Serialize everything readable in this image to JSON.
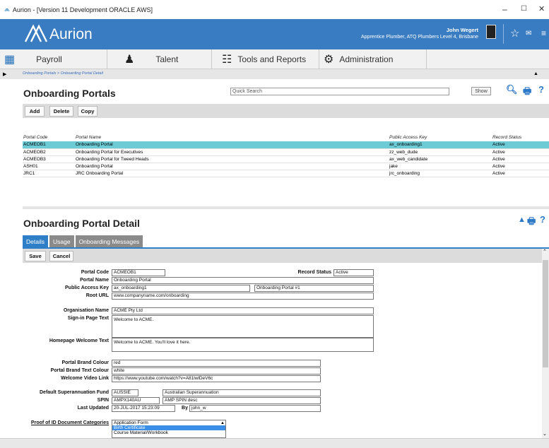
{
  "window": {
    "title": "Aurion - [Version 11 Development ORACLE AWS]",
    "minimize": "–",
    "maximize": "☐",
    "close": "✕"
  },
  "header": {
    "brand": "Aurion",
    "user_name": "John Wegert",
    "user_role": "Apprentice Plumber, ATQ Plumbers Level 4, Brisbane",
    "accent": "#3a7cc1"
  },
  "nav": {
    "items": [
      {
        "label": "Payroll",
        "icon": "payroll-icon"
      },
      {
        "label": "Talent",
        "icon": "talent-icon"
      },
      {
        "label": "Tools and Reports",
        "icon": "reports-icon"
      },
      {
        "label": "Administration",
        "icon": "admin-gears-icon"
      }
    ]
  },
  "breadcrumb": {
    "path": "Onboarding Portals   > Onboarding Portal Detail"
  },
  "portals": {
    "title": "Onboarding Portals",
    "search_placeholder": "Quick Search",
    "show_label": "Show",
    "buttons": {
      "add": "Add",
      "delete": "Delete",
      "copy": "Copy"
    },
    "columns": [
      "Portal Code",
      "Portal Name",
      "Public Access Key",
      "Record Status"
    ],
    "rows": [
      [
        "ACMEOB1",
        "Onboarding Portal",
        "ax_onboarding1",
        "Active"
      ],
      [
        "ACMEOB2",
        "Onboarding Portal for Executives",
        "zz_web_dude",
        "Active"
      ],
      [
        "ACMEOB3",
        "Onboarding Portal for Tweed Heads",
        "ax_web_candidate",
        "Active"
      ],
      [
        "ASH01",
        "Onboarding Portal",
        "jake",
        "Active"
      ],
      [
        "JRC1",
        "JRC Onboarding Portal",
        "jrc_onboarding",
        "Active"
      ]
    ]
  },
  "detail": {
    "title": "Onboarding Portal Detail",
    "tabs": [
      "Details",
      "Usage",
      "Onboarding Messages"
    ],
    "buttons": {
      "save": "Save",
      "cancel": "Cancel"
    },
    "labels": {
      "portal_code": "Portal Code",
      "portal_name": "Portal Name",
      "public_access_key": "Public Access Key",
      "root_url": "Root URL",
      "record_status": "Record Status",
      "org_name": "Organisation Name",
      "signin_text": "Sign-in Page Text",
      "homepage_text": "Homepage Welcome Text",
      "brand_colour": "Portal Brand Colour",
      "brand_text_colour": "Portal Brand Text Colour",
      "video_link": "Welcome Video Link",
      "super_fund": "Default Superannuation Fund",
      "spin": "SPIN",
      "last_updated": "Last Updated",
      "by": "By",
      "proof_id": "Proof of ID Document Categories"
    },
    "values": {
      "portal_code": "ACMEOB1",
      "portal_name": "Onboarding Portal",
      "public_access_key": "ax_onboarding1",
      "public_access_key_desc": "Onboarding Portal #1",
      "root_url": "www.companyname.com/onboarding",
      "record_status": "Active",
      "org_name": "ACME Pty Ltd",
      "signin_text": "Welcome to ACME.",
      "homepage_text": "Welcome to ACME. You'll love it here.",
      "brand_colour": "red",
      "brand_text_colour": "white",
      "video_link": "https://www.youtube.com/watch?v=A81lwlDeV6c",
      "super_fund_code": "AUSSIE",
      "super_fund_name": "Australian Superannuation",
      "spin": "AMPX140AU",
      "spin_desc": "AMP SPIN desc",
      "last_updated": "20-JUL-2017 15:23:09",
      "by": "john_w"
    },
    "proof_id_options": [
      "Application Form",
      "Birth Certificate",
      "Course Material/Workbook"
    ],
    "proof_id_selected": "Birth Certificate"
  }
}
